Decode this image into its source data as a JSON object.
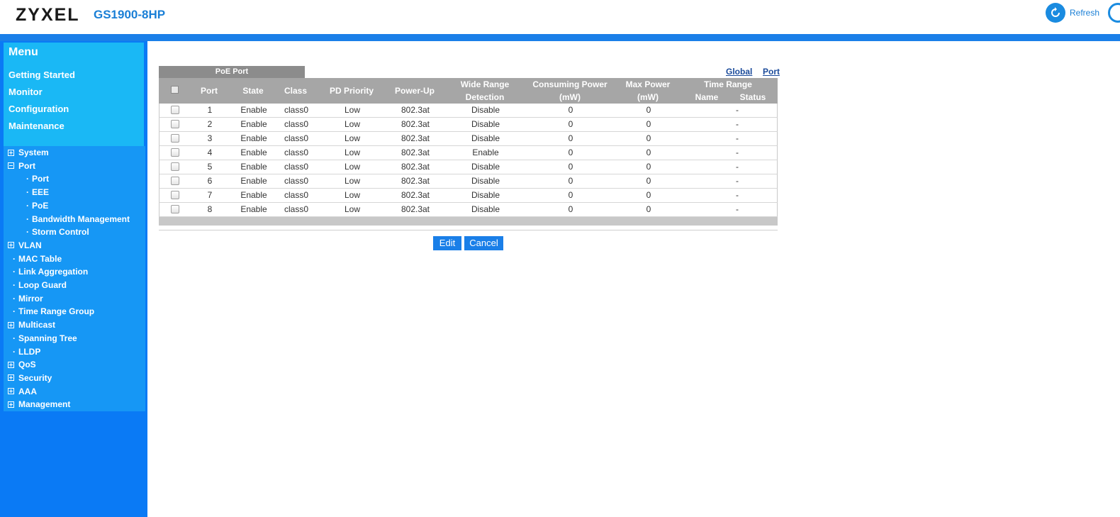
{
  "header": {
    "logo": "ZYXEL",
    "model": "GS1900-8HP",
    "refresh_label": "Refresh"
  },
  "sidebar": {
    "menu_title": "Menu",
    "menu_links": [
      "Getting Started",
      "Monitor",
      "Configuration",
      "Maintenance"
    ],
    "tree": [
      {
        "label": "System",
        "marker": "plus",
        "level": 0
      },
      {
        "label": "Port",
        "marker": "minus",
        "level": 0
      },
      {
        "label": "Port",
        "marker": "dot",
        "level": 1
      },
      {
        "label": "EEE",
        "marker": "dot",
        "level": 1
      },
      {
        "label": "PoE",
        "marker": "dot",
        "level": 1
      },
      {
        "label": "Bandwidth Management",
        "marker": "dot",
        "level": 1
      },
      {
        "label": "Storm Control",
        "marker": "dot",
        "level": 1
      },
      {
        "label": "VLAN",
        "marker": "plus",
        "level": 0
      },
      {
        "label": "MAC Table",
        "marker": "dot",
        "level": 0
      },
      {
        "label": "Link Aggregation",
        "marker": "dot",
        "level": 0
      },
      {
        "label": "Loop Guard",
        "marker": "dot",
        "level": 0
      },
      {
        "label": "Mirror",
        "marker": "dot",
        "level": 0
      },
      {
        "label": "Time Range Group",
        "marker": "dot",
        "level": 0
      },
      {
        "label": "Multicast",
        "marker": "plus",
        "level": 0
      },
      {
        "label": "Spanning Tree",
        "marker": "dot",
        "level": 0
      },
      {
        "label": "LLDP",
        "marker": "dot",
        "level": 0
      },
      {
        "label": "QoS",
        "marker": "plus",
        "level": 0
      },
      {
        "label": "Security",
        "marker": "plus",
        "level": 0
      },
      {
        "label": "AAA",
        "marker": "plus",
        "level": 0
      },
      {
        "label": "Management",
        "marker": "plus",
        "level": 0
      }
    ]
  },
  "main": {
    "tab_label": "PoE Port",
    "links": {
      "global": "Global",
      "port": "Port"
    },
    "table": {
      "headers": {
        "port": "Port",
        "state": "State",
        "class": "Class",
        "pd_priority": "PD Priority",
        "power_up": "Power-Up",
        "wide_range_1": "Wide Range",
        "wide_range_2": "Detection",
        "consuming_1": "Consuming Power",
        "consuming_2": "(mW)",
        "max_1": "Max Power",
        "max_2": "(mW)",
        "time_range": "Time Range",
        "tr_name": "Name",
        "tr_status": "Status"
      },
      "rows": [
        {
          "port": "1",
          "state": "Enable",
          "class": "class0",
          "priority": "Low",
          "power_up": "802.3at",
          "detection": "Disable",
          "consuming": "0",
          "max": "0",
          "name": "",
          "status": "-"
        },
        {
          "port": "2",
          "state": "Enable",
          "class": "class0",
          "priority": "Low",
          "power_up": "802.3at",
          "detection": "Disable",
          "consuming": "0",
          "max": "0",
          "name": "",
          "status": "-"
        },
        {
          "port": "3",
          "state": "Enable",
          "class": "class0",
          "priority": "Low",
          "power_up": "802.3at",
          "detection": "Disable",
          "consuming": "0",
          "max": "0",
          "name": "",
          "status": "-"
        },
        {
          "port": "4",
          "state": "Enable",
          "class": "class0",
          "priority": "Low",
          "power_up": "802.3at",
          "detection": "Enable",
          "consuming": "0",
          "max": "0",
          "name": "",
          "status": "-"
        },
        {
          "port": "5",
          "state": "Enable",
          "class": "class0",
          "priority": "Low",
          "power_up": "802.3at",
          "detection": "Disable",
          "consuming": "0",
          "max": "0",
          "name": "",
          "status": "-"
        },
        {
          "port": "6",
          "state": "Enable",
          "class": "class0",
          "priority": "Low",
          "power_up": "802.3at",
          "detection": "Disable",
          "consuming": "0",
          "max": "0",
          "name": "",
          "status": "-"
        },
        {
          "port": "7",
          "state": "Enable",
          "class": "class0",
          "priority": "Low",
          "power_up": "802.3at",
          "detection": "Disable",
          "consuming": "0",
          "max": "0",
          "name": "",
          "status": "-"
        },
        {
          "port": "8",
          "state": "Enable",
          "class": "class0",
          "priority": "Low",
          "power_up": "802.3at",
          "detection": "Disable",
          "consuming": "0",
          "max": "0",
          "name": "",
          "status": "-"
        }
      ]
    },
    "buttons": {
      "edit": "Edit",
      "cancel": "Cancel"
    }
  },
  "colors": {
    "brand_blue": "#1a7fe8",
    "sidebar_blue": "#0a7af5",
    "menu_box": "#1ab8f5",
    "table_header": "#a6a6a6"
  }
}
